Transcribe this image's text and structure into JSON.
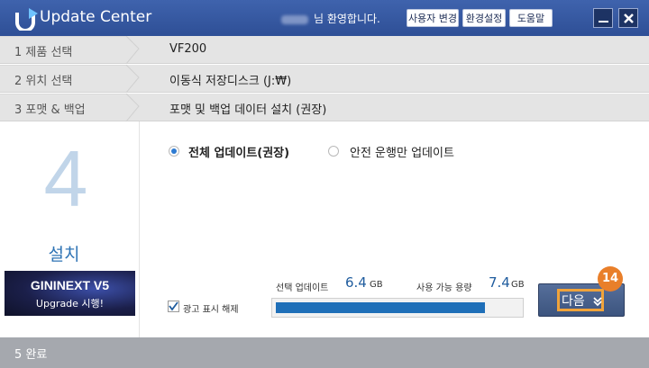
{
  "app": {
    "title": "Update Center"
  },
  "header": {
    "welcome": "님 환영합니다.",
    "buttons": [
      "사용자 변경",
      "환경설정",
      "도움말"
    ]
  },
  "steps": [
    {
      "label": "1  제품 선택",
      "value": "VF200"
    },
    {
      "label": "2  위치 선택",
      "value": "이동식 저장디스크 (J:₩)"
    },
    {
      "label": "3  포맷 & 백업",
      "value": "포맷 및 백업 데이터 설치 (권장)"
    },
    {
      "label": "4",
      "name": "설치"
    },
    {
      "label": "5  완료"
    }
  ],
  "options": {
    "full": "전체 업데이트(권장)",
    "safe": "안전 운행만 업데이트",
    "selected": "full"
  },
  "ad": {
    "title": "GININEXT V5",
    "subtitle": "Upgrade 시행!"
  },
  "ad_hide_label": "광고 표시 해제",
  "selected_update": {
    "label": "선택 업데이트",
    "value": "6.4",
    "unit": "GB"
  },
  "available_space": {
    "label": "사용 가능 용량",
    "value": "7.4",
    "unit": "GB"
  },
  "progress": 0.86,
  "next_button": {
    "label": "다음",
    "badge": "14"
  },
  "colors": {
    "titlebar": "#2e4f96",
    "accent": "#2f74b5",
    "highlight": "#f0a33a"
  }
}
